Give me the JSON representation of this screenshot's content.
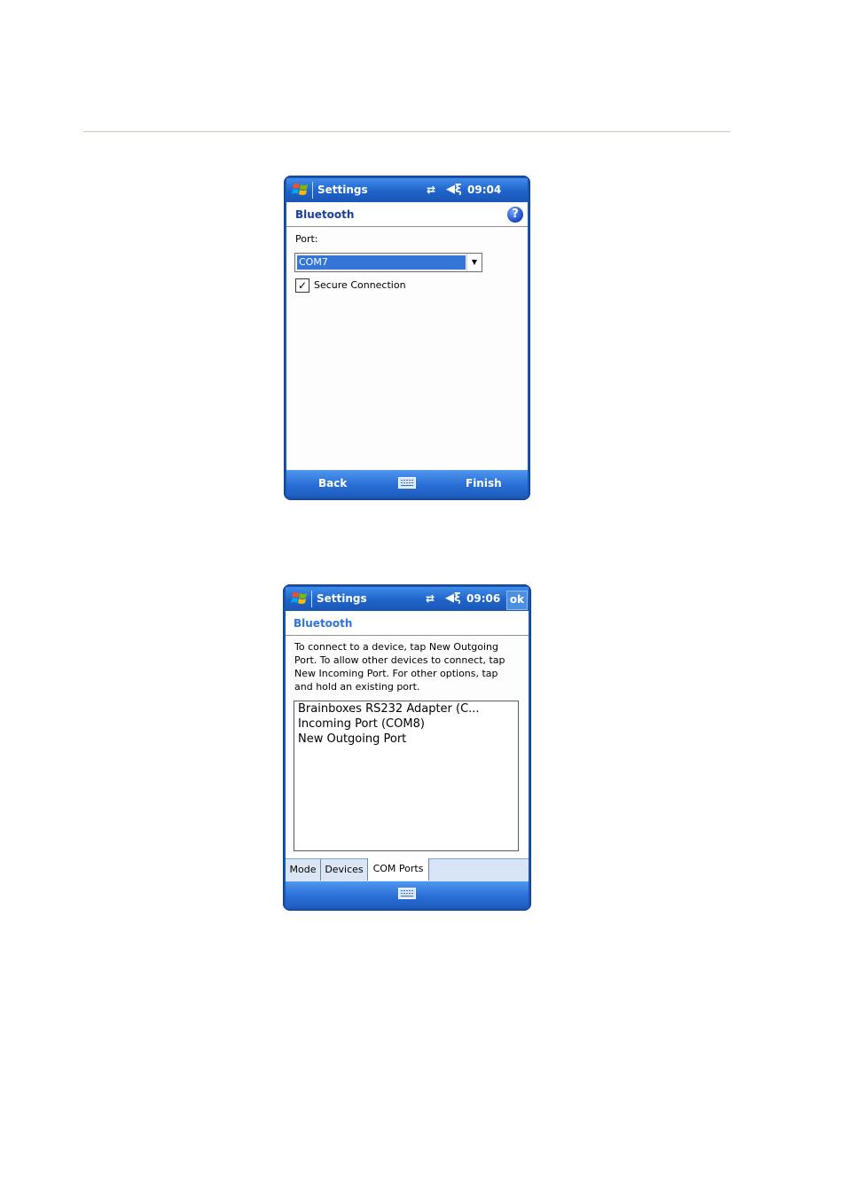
{
  "screen1": {
    "titlebar": {
      "app": "Settings",
      "time": "09:04"
    },
    "header": {
      "title": "Bluetooth",
      "help_glyph": "?"
    },
    "port_label": "Port:",
    "port_value": "COM7",
    "secure_label": "Secure Connection",
    "secure_checked": true,
    "bottom": {
      "back": "Back",
      "finish": "Finish"
    }
  },
  "screen2": {
    "titlebar": {
      "app": "Settings",
      "time": "09:06",
      "ok": "ok"
    },
    "header": {
      "title": "Bluetooth"
    },
    "instructions": [
      "To connect to a device, tap New Outgoing",
      "Port. To allow other devices to connect, tap",
      "New Incoming Port. For other options, tap",
      "and hold an existing port."
    ],
    "list_items": [
      "Brainboxes RS232 Adapter (C...",
      "Incoming Port (COM8)",
      "New Outgoing Port"
    ],
    "tabs": [
      "Mode",
      "Devices",
      "COM Ports"
    ],
    "active_tab": "COM Ports"
  },
  "colors": {
    "titlebar": "#1f63c8",
    "header_text_screen1": "#1a3f97",
    "header_text_screen2": "#2f74d8",
    "selection": "#3476d8"
  },
  "icons": [
    "windows-flag-icon",
    "connectivity-icon",
    "speaker-muted-icon",
    "help-icon",
    "keyboard-icon",
    "dropdown-arrow-icon",
    "checkmark-icon"
  ]
}
